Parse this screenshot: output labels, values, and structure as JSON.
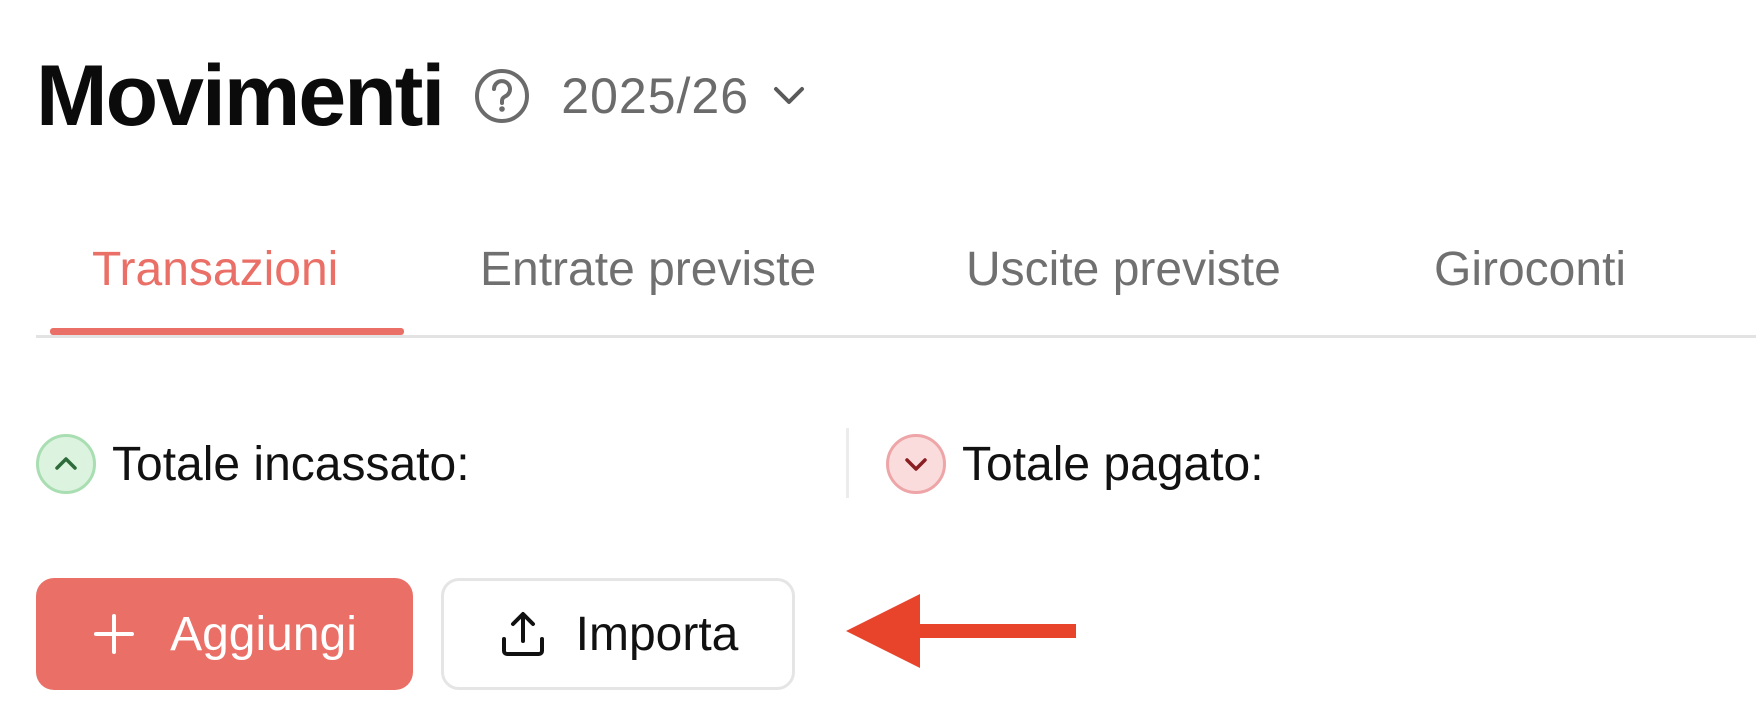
{
  "header": {
    "title": "Movimenti",
    "help_icon": "question-circle-icon",
    "year": "2025/26"
  },
  "tabs": [
    {
      "label": "Transazioni",
      "active": true
    },
    {
      "label": "Entrate previste",
      "active": false
    },
    {
      "label": "Uscite previste",
      "active": false
    },
    {
      "label": "Giroconti",
      "active": false
    }
  ],
  "totals": {
    "income_label": "Totale incassato:",
    "expense_label": "Totale pagato:"
  },
  "actions": {
    "add_label": "Aggiungi",
    "import_label": "Importa"
  },
  "colors": {
    "accent": "#ea6f67",
    "annotation_arrow": "#e8432b",
    "income_green": "#a9deb2",
    "expense_red": "#eea5a7"
  }
}
